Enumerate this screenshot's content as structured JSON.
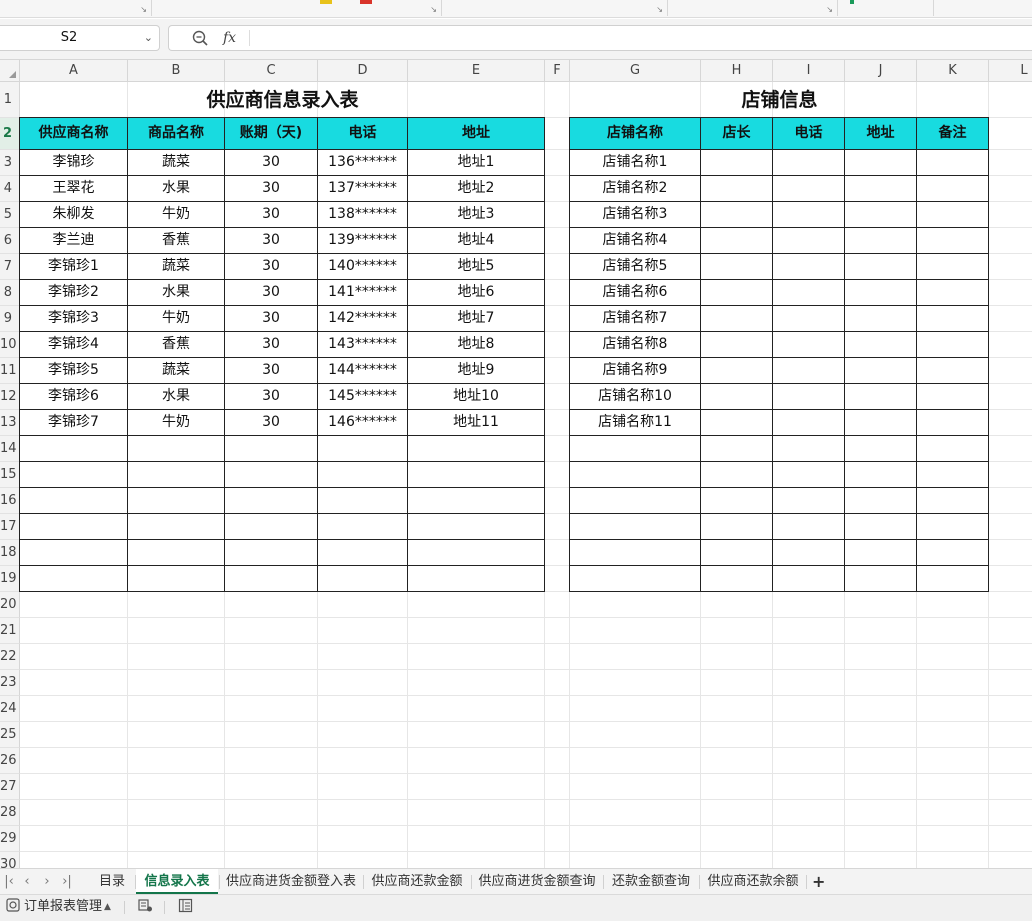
{
  "formula_bar": {
    "name_box": "S2",
    "fx_label": "fx",
    "formula": ""
  },
  "columns": [
    "A",
    "B",
    "C",
    "D",
    "E",
    "F",
    "G",
    "H",
    "I",
    "J",
    "K",
    "L"
  ],
  "rows": [
    "1",
    "2",
    "3",
    "4",
    "5",
    "6",
    "7",
    "8",
    "9",
    "10",
    "11",
    "12",
    "13",
    "14",
    "15",
    "16",
    "17",
    "18",
    "19",
    "20",
    "21",
    "22",
    "23",
    "24",
    "25",
    "26",
    "27",
    "28",
    "29",
    "30",
    "31"
  ],
  "active_row": "2",
  "supplier_table": {
    "title": "供应商信息录入表",
    "headers": [
      "供应商名称",
      "商品名称",
      "账期（天)",
      "电话",
      "地址"
    ],
    "rows": [
      [
        "李锦珍",
        "蔬菜",
        "30",
        "136******",
        "地址1"
      ],
      [
        "王翠花",
        "水果",
        "30",
        "137******",
        "地址2"
      ],
      [
        "朱柳发",
        "牛奶",
        "30",
        "138******",
        "地址3"
      ],
      [
        "李兰迪",
        "香蕉",
        "30",
        "139******",
        "地址4"
      ],
      [
        "李锦珍1",
        "蔬菜",
        "30",
        "140******",
        "地址5"
      ],
      [
        "李锦珍2",
        "水果",
        "30",
        "141******",
        "地址6"
      ],
      [
        "李锦珍3",
        "牛奶",
        "30",
        "142******",
        "地址7"
      ],
      [
        "李锦珍4",
        "香蕉",
        "30",
        "143******",
        "地址8"
      ],
      [
        "李锦珍5",
        "蔬菜",
        "30",
        "144******",
        "地址9"
      ],
      [
        "李锦珍6",
        "水果",
        "30",
        "145******",
        "地址10"
      ],
      [
        "李锦珍7",
        "牛奶",
        "30",
        "146******",
        "地址11"
      ],
      [
        "",
        "",
        "",
        "",
        ""
      ],
      [
        "",
        "",
        "",
        "",
        ""
      ],
      [
        "",
        "",
        "",
        "",
        ""
      ],
      [
        "",
        "",
        "",
        "",
        ""
      ],
      [
        "",
        "",
        "",
        "",
        ""
      ],
      [
        "",
        "",
        "",
        "",
        ""
      ]
    ]
  },
  "store_table": {
    "title": "店铺信息",
    "headers": [
      "店铺名称",
      "店长",
      "电话",
      "地址",
      "备注"
    ],
    "rows": [
      [
        "店铺名称1",
        "",
        "",
        "",
        ""
      ],
      [
        "店铺名称2",
        "",
        "",
        "",
        ""
      ],
      [
        "店铺名称3",
        "",
        "",
        "",
        ""
      ],
      [
        "店铺名称4",
        "",
        "",
        "",
        ""
      ],
      [
        "店铺名称5",
        "",
        "",
        "",
        ""
      ],
      [
        "店铺名称6",
        "",
        "",
        "",
        ""
      ],
      [
        "店铺名称7",
        "",
        "",
        "",
        ""
      ],
      [
        "店铺名称8",
        "",
        "",
        "",
        ""
      ],
      [
        "店铺名称9",
        "",
        "",
        "",
        ""
      ],
      [
        "店铺名称10",
        "",
        "",
        "",
        ""
      ],
      [
        "店铺名称11",
        "",
        "",
        "",
        ""
      ],
      [
        "",
        "",
        "",
        "",
        ""
      ],
      [
        "",
        "",
        "",
        "",
        ""
      ],
      [
        "",
        "",
        "",
        "",
        ""
      ],
      [
        "",
        "",
        "",
        "",
        ""
      ],
      [
        "",
        "",
        "",
        "",
        ""
      ],
      [
        "",
        "",
        "",
        "",
        ""
      ]
    ]
  },
  "sheet_tabs": {
    "items": [
      "目录",
      "信息录入表",
      "供应商进货金额登入表",
      "供应商还款金额",
      "供应商进货金额查询",
      "还款金额查询",
      "供应商还款余额"
    ],
    "active": "信息录入表",
    "add_label": "+",
    "nav_icons": [
      "first-sheet-icon",
      "prev-sheet-icon",
      "next-sheet-icon",
      "last-sheet-icon"
    ]
  },
  "status_bar": {
    "macro_label": "订单报表管理",
    "macro_caret": "▲"
  },
  "colors": {
    "table_header_fill": "#18dbe0",
    "active_tab": "#13754a"
  }
}
